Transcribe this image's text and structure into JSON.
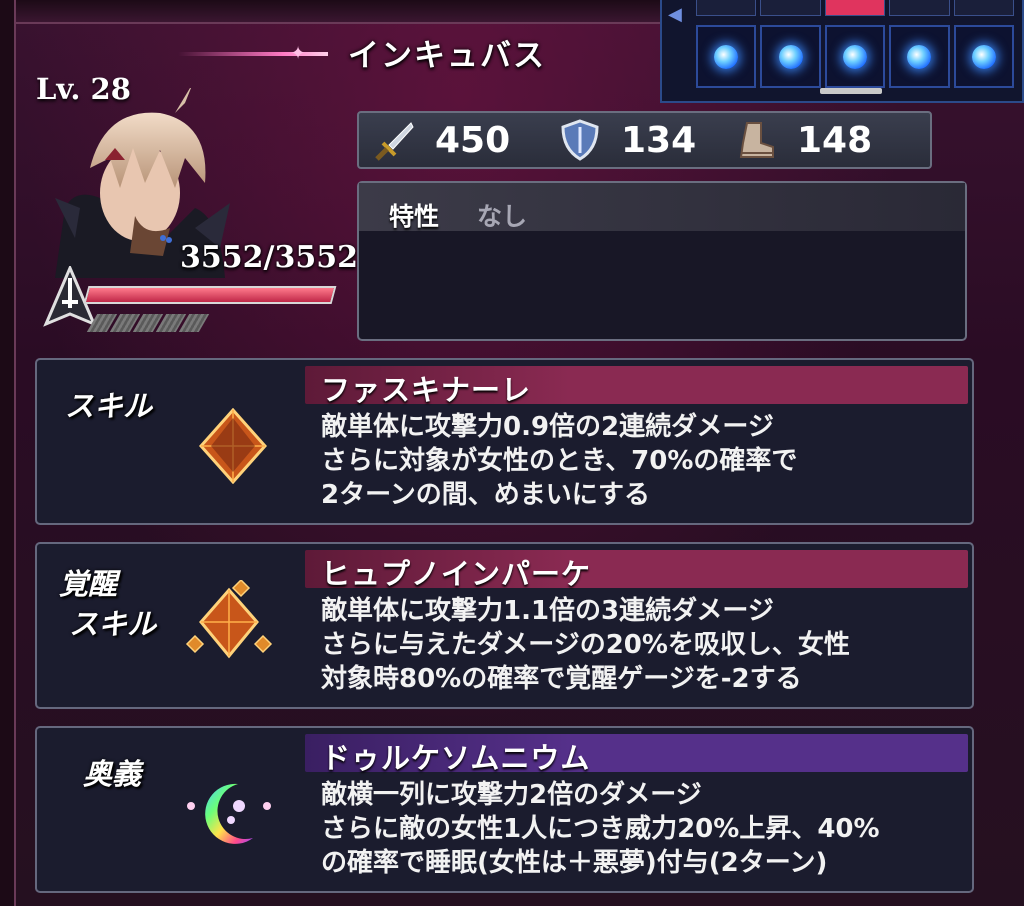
{
  "unit": {
    "name": "インキュバス",
    "level": "Lv. 28",
    "hp": "3552/3552",
    "hp_ratio": 1.0
  },
  "party": {
    "slots": 5,
    "selected_index": 2
  },
  "stats": [
    {
      "icon": "sword-icon",
      "value": "450"
    },
    {
      "icon": "shield-icon",
      "value": "134"
    },
    {
      "icon": "boot-icon",
      "value": "148"
    }
  ],
  "trait": {
    "label": "特性",
    "value": "なし"
  },
  "skills": [
    {
      "label": "スキル",
      "name": "ファスキナーレ",
      "description": "敵単体に攻撃力0.9倍の2連続ダメージ\nさらに対象が女性のとき、70%の確率で\n2ターンの間、めまいにする",
      "icon": "orange-crystal-icon",
      "header_color": "#8a2a52"
    },
    {
      "label": "覚醒\n スキル",
      "name": "ヒュプノインパーケ",
      "description": "敵単体に攻撃力1.1倍の3連続ダメージ\nさらに与えたダメージの20%を吸収し、女性\n対象時80%の確率で覚醒ゲージを-2する",
      "icon": "awakened-crystal-icon",
      "header_color": "#8a2a52"
    },
    {
      "label": "奥義",
      "name": "ドゥルケソムニウム",
      "description": "敵横一列に攻撃力2倍のダメージ\nさらに敵の女性1人につき威力20%上昇、40%\nの確率で睡眠(女性は＋悪夢)付与(2ターン)",
      "icon": "rainbow-moon-icon",
      "header_color": "#55308a"
    }
  ]
}
